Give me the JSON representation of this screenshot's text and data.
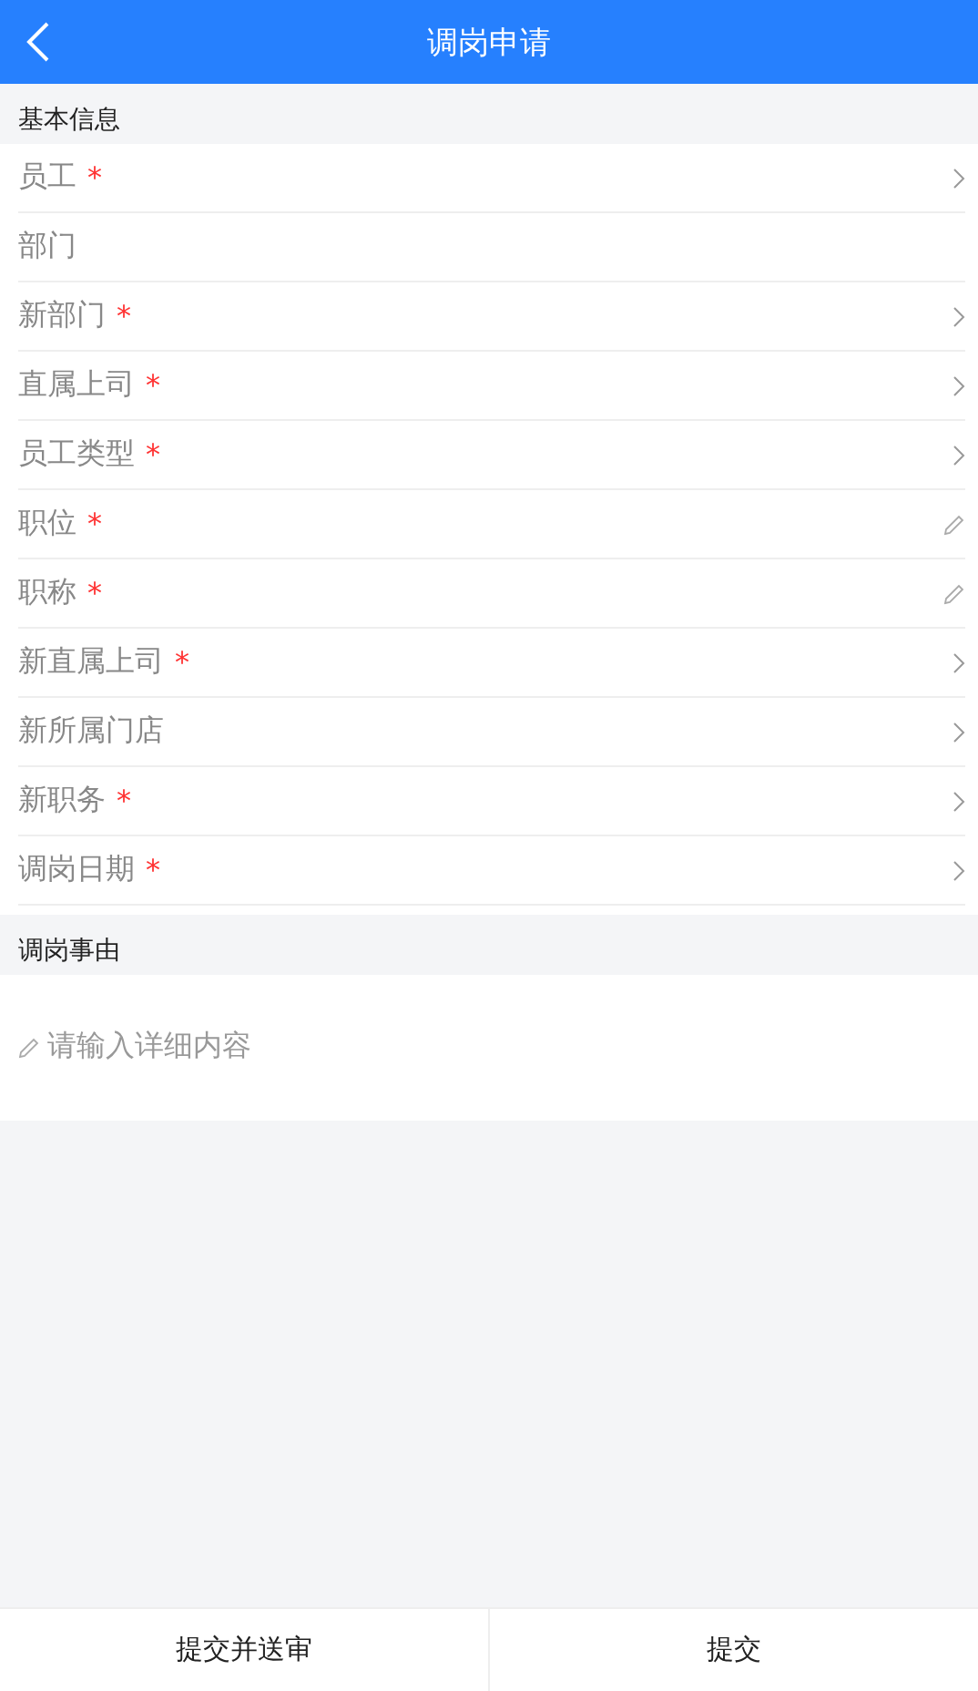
{
  "header": {
    "title": "调岗申请"
  },
  "sections": [
    {
      "title": "基本信息",
      "rows": [
        {
          "label": "员工",
          "mark": "*",
          "kind": "select"
        },
        {
          "label": "部门",
          "kind": "plain"
        },
        {
          "label": "新部门",
          "mark": "*",
          "kind": "select"
        },
        {
          "label": "直属上司",
          "mark": "*",
          "kind": "select"
        },
        {
          "label": "员工类型",
          "mark": "*",
          "kind": "select"
        },
        {
          "label": "职位",
          "mark": "*",
          "kind": "edit"
        },
        {
          "label": "职称",
          "mark": "*",
          "kind": "edit"
        },
        {
          "label": "新直属上司",
          "mark": "*",
          "kind": "select"
        },
        {
          "label": "新所属门店",
          "kind": "select"
        },
        {
          "label": "新职务",
          "mark": "*",
          "kind": "select"
        },
        {
          "label": "调岗日期",
          "mark": "*",
          "kind": "select"
        }
      ]
    },
    {
      "title": "调岗事由",
      "reason": {
        "placeholder": "请输入详细内容"
      }
    }
  ],
  "buttons": [
    "提交并送审",
    "提交"
  ]
}
